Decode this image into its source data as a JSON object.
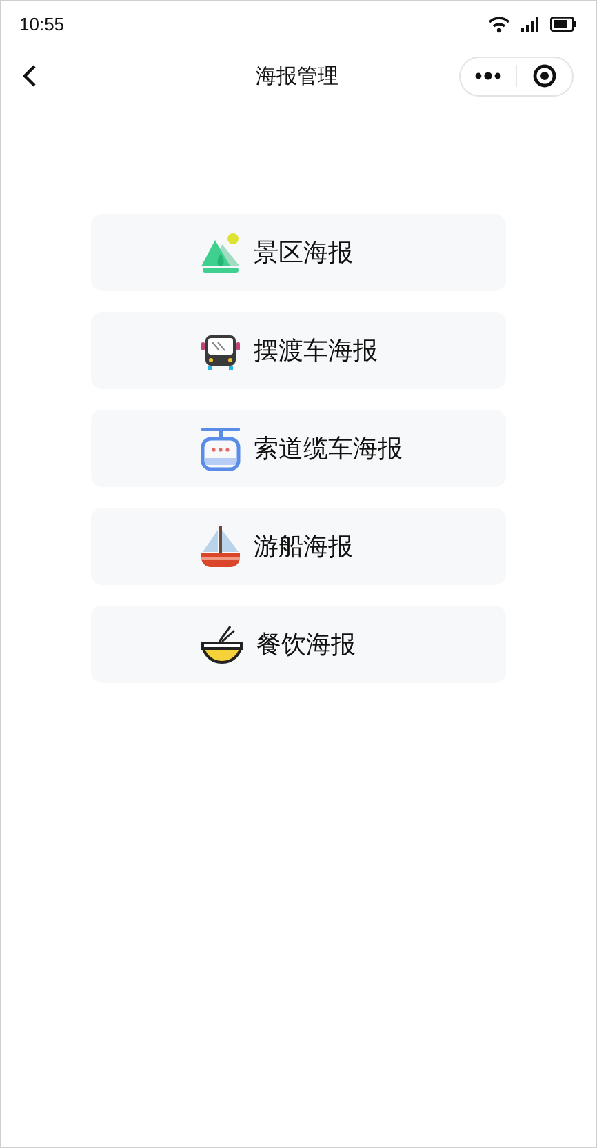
{
  "status_bar": {
    "time": "10:55"
  },
  "nav_bar": {
    "title": "海报管理"
  },
  "menu": [
    {
      "kind": "scenic",
      "label": "景区海报"
    },
    {
      "kind": "shuttle",
      "label": "摆渡车海报"
    },
    {
      "kind": "cablecar",
      "label": "索道缆车海报"
    },
    {
      "kind": "cruise",
      "label": "游船海报"
    },
    {
      "kind": "dining",
      "label": "餐饮海报"
    }
  ]
}
